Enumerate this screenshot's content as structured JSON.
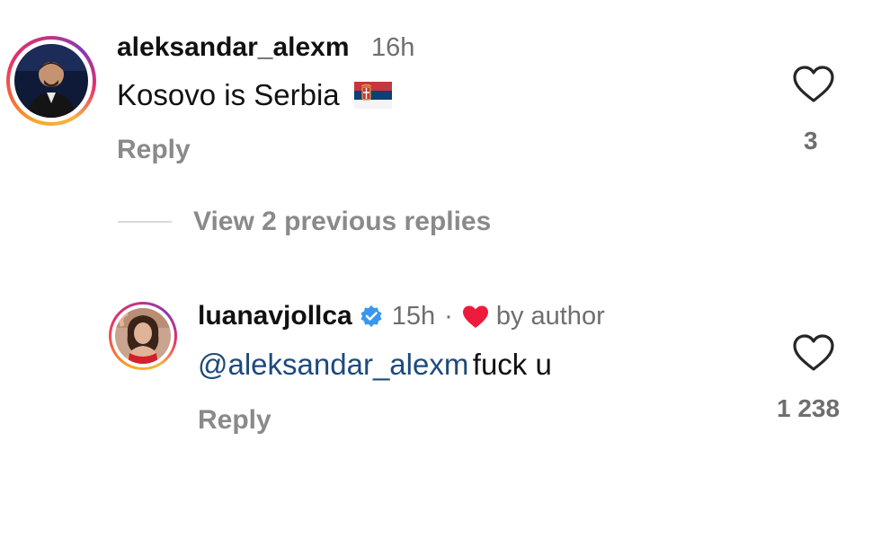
{
  "comment": {
    "username": "aleksandar_alexm",
    "time": "16h",
    "text": "Kosovo is Serbia",
    "flag_icon": "serbia-flag-icon",
    "reply_label": "Reply",
    "like_count": "3"
  },
  "view_replies": {
    "label": "View 2 previous replies"
  },
  "reply": {
    "username": "luanavjollca",
    "verified_icon": "verified-badge-icon",
    "time": "15h",
    "separator": "·",
    "liked_by_author_icon": "red-heart-icon",
    "liked_by_author_label": "by author",
    "mention": "@aleksandar_alexm",
    "text": "fuck u",
    "reply_label": "Reply",
    "like_count": "1 238"
  },
  "colors": {
    "mention": "#1e4a7c",
    "secondary": "#8a8a8a",
    "heart_red": "#ed1c3c",
    "verified_blue": "#3897f0"
  }
}
